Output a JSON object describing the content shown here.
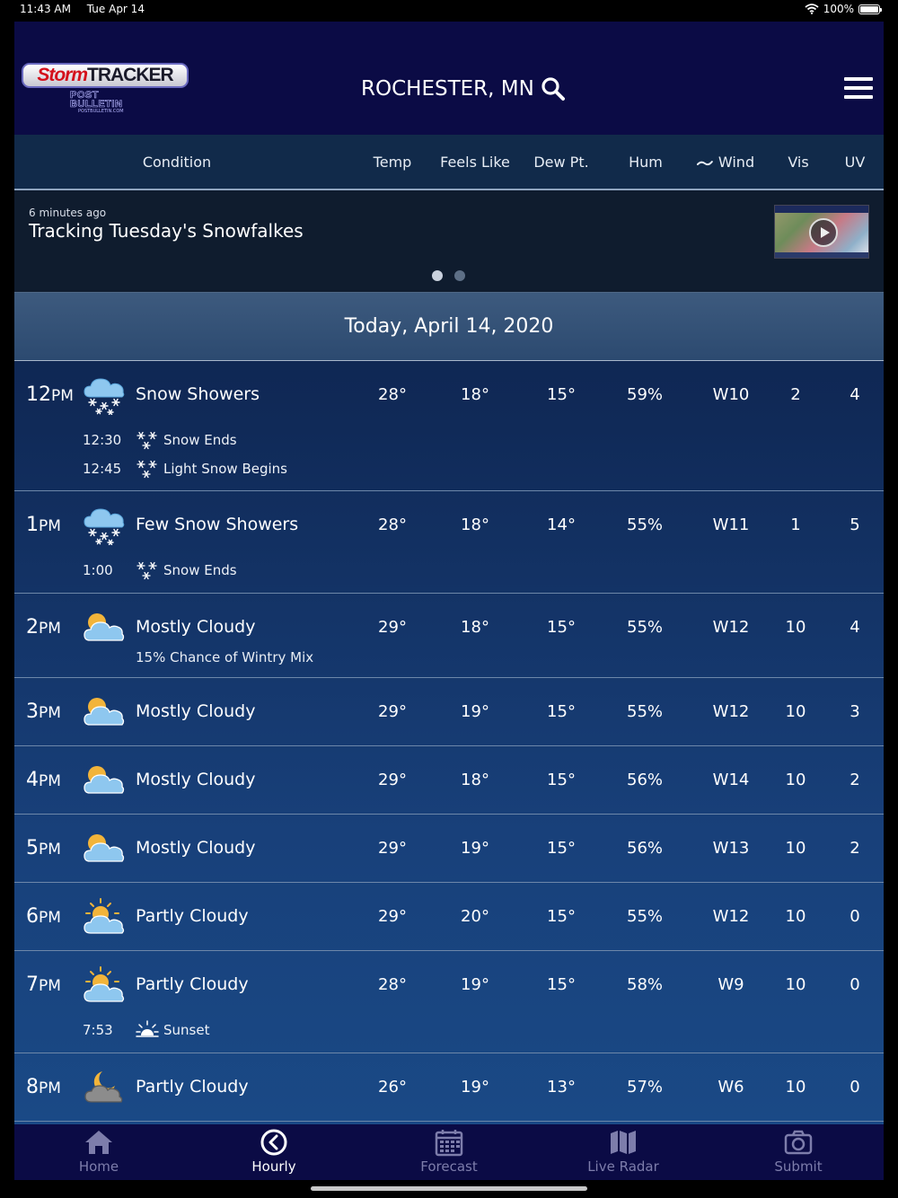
{
  "status_bar": {
    "time": "11:43 AM",
    "date": "Tue Apr 14",
    "battery": "100%"
  },
  "header": {
    "logo_storm": "Storm",
    "logo_tracker": "TRACKER",
    "logo_sub_line1": "POST",
    "logo_sub_line2": "BULLETIN",
    "logo_url": "POSTBULLETIN.COM",
    "location": "ROCHESTER, MN"
  },
  "columns": {
    "condition": "Condition",
    "temp": "Temp",
    "feels_like": "Feels Like",
    "dew_pt": "Dew Pt.",
    "hum": "Hum",
    "wind": "Wind",
    "vis": "Vis",
    "uv": "UV"
  },
  "news": {
    "ago": "6 minutes ago",
    "headline": "Tracking Tuesday's Snowfalkes"
  },
  "date_label": "Today, April 14, 2020",
  "hours": [
    {
      "hour": "12",
      "ampm": "PM",
      "icon": "snow-cloud-icon",
      "condition": "Snow Showers",
      "temp": "28°",
      "feels": "18°",
      "dew": "15°",
      "hum": "59%",
      "wind": "W10",
      "vis": "2",
      "uv": "4",
      "subs": [
        {
          "time": "12:30",
          "icon": "snowflake-icon",
          "text": "Snow Ends"
        },
        {
          "time": "12:45",
          "icon": "snowflake-icon",
          "text": "Light Snow Begins"
        }
      ]
    },
    {
      "hour": "1",
      "ampm": "PM",
      "icon": "snow-cloud-icon",
      "condition": "Few Snow Showers",
      "temp": "28°",
      "feels": "18°",
      "dew": "14°",
      "hum": "55%",
      "wind": "W11",
      "vis": "1",
      "uv": "5",
      "subs": [
        {
          "time": "1:00",
          "icon": "snowflake-icon",
          "text": "Snow Ends"
        }
      ]
    },
    {
      "hour": "2",
      "ampm": "PM",
      "icon": "mostly-cloudy-icon",
      "condition": "Mostly Cloudy",
      "note": "15% Chance of Wintry Mix",
      "temp": "29°",
      "feels": "18°",
      "dew": "15°",
      "hum": "55%",
      "wind": "W12",
      "vis": "10",
      "uv": "4"
    },
    {
      "hour": "3",
      "ampm": "PM",
      "icon": "mostly-cloudy-icon",
      "condition": "Mostly Cloudy",
      "temp": "29°",
      "feels": "19°",
      "dew": "15°",
      "hum": "55%",
      "wind": "W12",
      "vis": "10",
      "uv": "3"
    },
    {
      "hour": "4",
      "ampm": "PM",
      "icon": "mostly-cloudy-icon",
      "condition": "Mostly Cloudy",
      "temp": "29°",
      "feels": "18°",
      "dew": "15°",
      "hum": "56%",
      "wind": "W14",
      "vis": "10",
      "uv": "2"
    },
    {
      "hour": "5",
      "ampm": "PM",
      "icon": "mostly-cloudy-icon",
      "condition": "Mostly Cloudy",
      "temp": "29°",
      "feels": "19°",
      "dew": "15°",
      "hum": "56%",
      "wind": "W13",
      "vis": "10",
      "uv": "2"
    },
    {
      "hour": "6",
      "ampm": "PM",
      "icon": "partly-cloudy-icon",
      "condition": "Partly Cloudy",
      "temp": "29°",
      "feels": "20°",
      "dew": "15°",
      "hum": "55%",
      "wind": "W12",
      "vis": "10",
      "uv": "0"
    },
    {
      "hour": "7",
      "ampm": "PM",
      "icon": "partly-cloudy-icon",
      "condition": "Partly Cloudy",
      "temp": "28°",
      "feels": "19°",
      "dew": "15°",
      "hum": "58%",
      "wind": "W9",
      "vis": "10",
      "uv": "0",
      "subs": [
        {
          "time": "7:53",
          "icon": "sunset-icon",
          "text": "Sunset"
        }
      ]
    },
    {
      "hour": "8",
      "ampm": "PM",
      "icon": "partly-cloudy-night-icon",
      "condition": "Partly Cloudy",
      "temp": "26°",
      "feels": "19°",
      "dew": "13°",
      "hum": "57%",
      "wind": "W6",
      "vis": "10",
      "uv": "0"
    }
  ],
  "tabs": [
    {
      "id": "home",
      "label": "Home",
      "icon": "home-icon"
    },
    {
      "id": "hourly",
      "label": "Hourly",
      "icon": "clock-back-icon",
      "active": true
    },
    {
      "id": "forecast",
      "label": "Forecast",
      "icon": "calendar-icon"
    },
    {
      "id": "radar",
      "label": "Live Radar",
      "icon": "map-icon"
    },
    {
      "id": "submit",
      "label": "Submit",
      "icon": "camera-icon"
    }
  ],
  "colors": {
    "header_bg": "#0b0b45",
    "inactive_tab": "#7d7dab",
    "sun": "#f2b43a",
    "cloud": "#8ec7ef"
  }
}
